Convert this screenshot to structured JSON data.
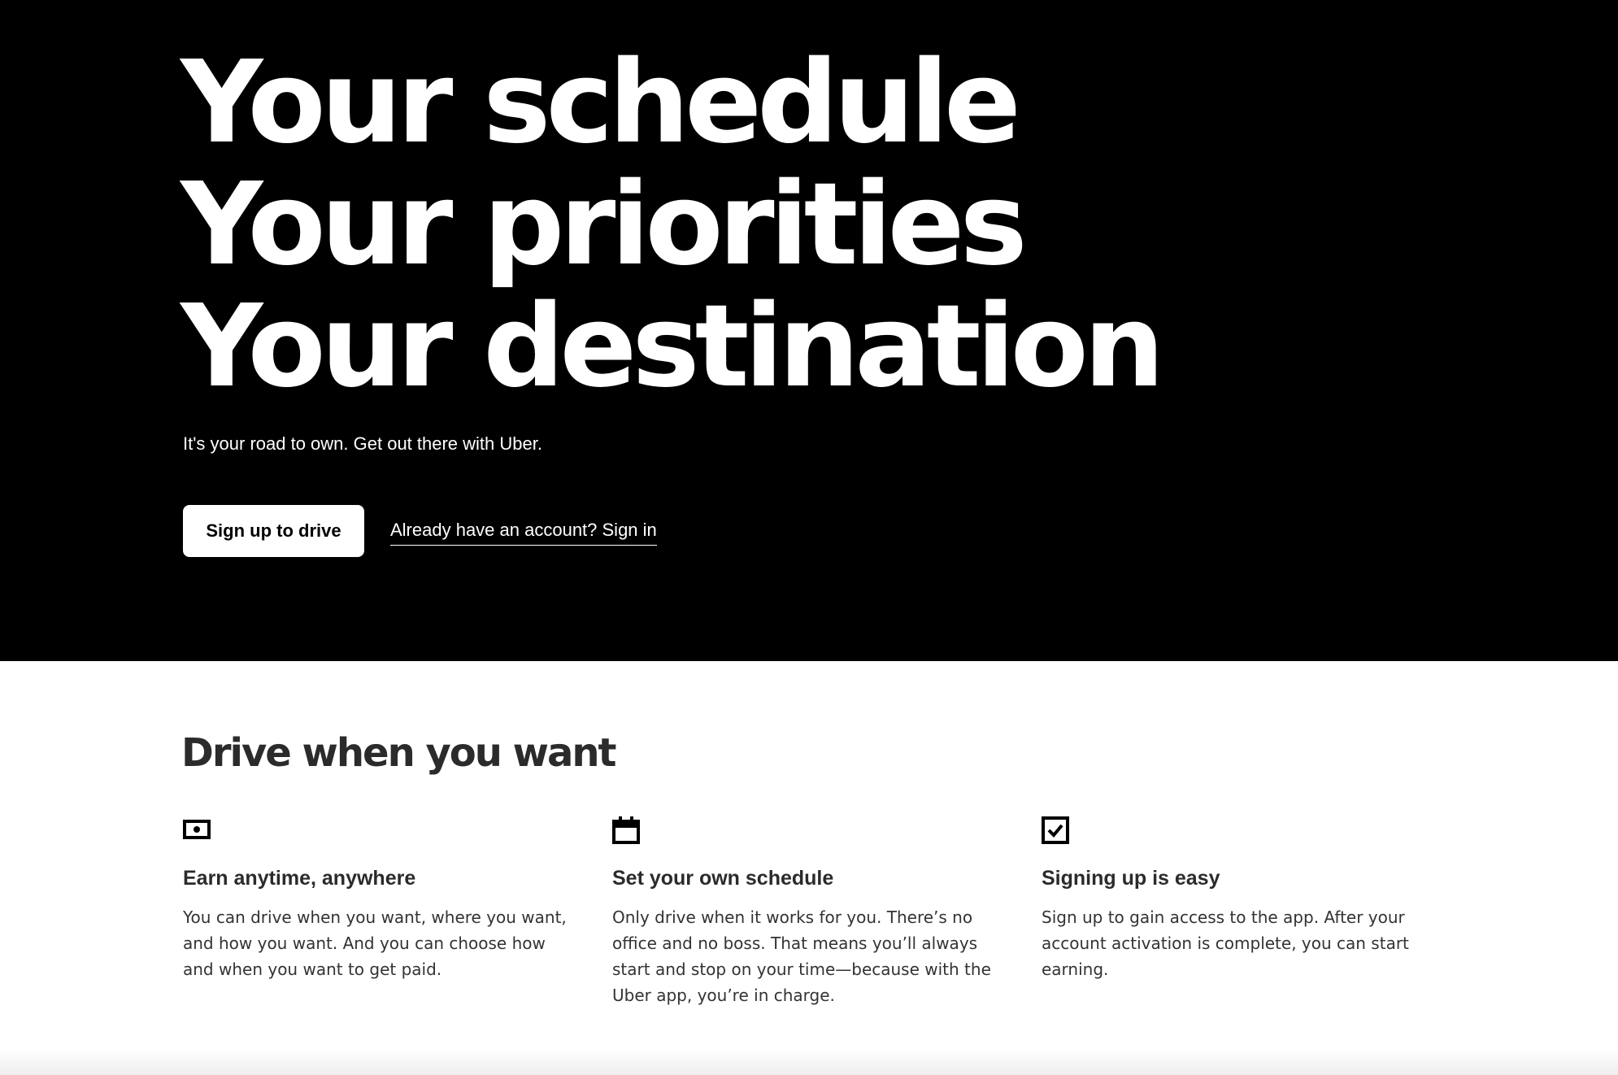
{
  "hero": {
    "headline_lines": [
      "Your schedule",
      "Your priorities",
      "Your destination"
    ],
    "tagline": "It's your road to own. Get out there with Uber.",
    "signup_button_label": "Sign up to drive",
    "signin_link_label": "Already have an account? Sign in"
  },
  "benefits": {
    "title": "Drive when you want",
    "items": [
      {
        "icon": "cash-icon",
        "title": "Earn anytime, anywhere",
        "body": "You can drive when you want, where you want, and how you want. And you can choose how and when you want to get paid."
      },
      {
        "icon": "calendar-icon",
        "title": "Set your own schedule",
        "body": "Only drive when it works for you. There’s no office and no boss. That means you’ll always start and stop on your time—because with the Uber app, you’re in charge."
      },
      {
        "icon": "checkbox-icon",
        "title": "Signing up is easy",
        "body": "Sign up to gain access to the app. After your account activation is complete, you can start earning."
      }
    ]
  },
  "colors": {
    "hero_background": "#000000",
    "hero_text": "#ffffff",
    "heading_text": "#2b2b2b",
    "body_text": "#333333"
  }
}
